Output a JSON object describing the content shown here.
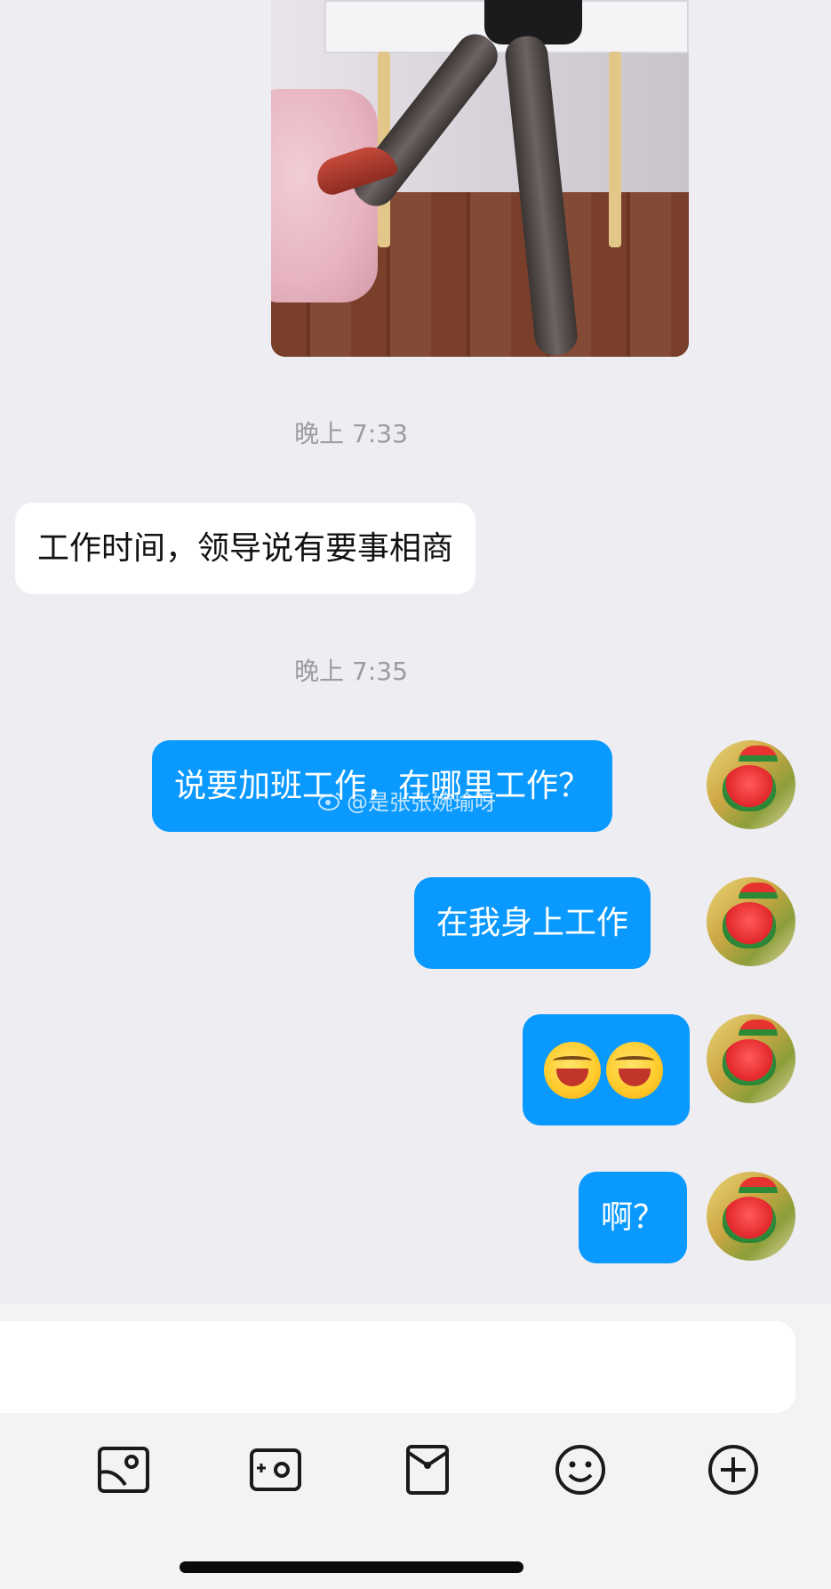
{
  "messages": [
    {
      "type": "image",
      "side": "left",
      "description": "photo"
    },
    {
      "type": "time",
      "text": "晚上 7:33"
    },
    {
      "type": "text",
      "side": "left",
      "text": "工作时间，领导说有要事相商"
    },
    {
      "type": "time",
      "text": "晚上 7:35"
    },
    {
      "type": "text",
      "side": "right",
      "text": "说要加班工作，在哪里工作？"
    },
    {
      "type": "text",
      "side": "right",
      "text": "在我身上工作"
    },
    {
      "type": "emoji",
      "side": "right",
      "count": 2
    },
    {
      "type": "text",
      "side": "right",
      "text": "啊？"
    }
  ],
  "watermark": "@是张张婉瑜呀",
  "composer": {
    "value": "",
    "placeholder": ""
  },
  "toolbar": {
    "icons": [
      "image-icon",
      "camera-icon",
      "red-packet-icon",
      "emoji-icon",
      "plus-icon"
    ]
  },
  "colors": {
    "sent_bubble": "#0a99ff",
    "received_bubble": "#ffffff",
    "background": "#ededf2"
  }
}
